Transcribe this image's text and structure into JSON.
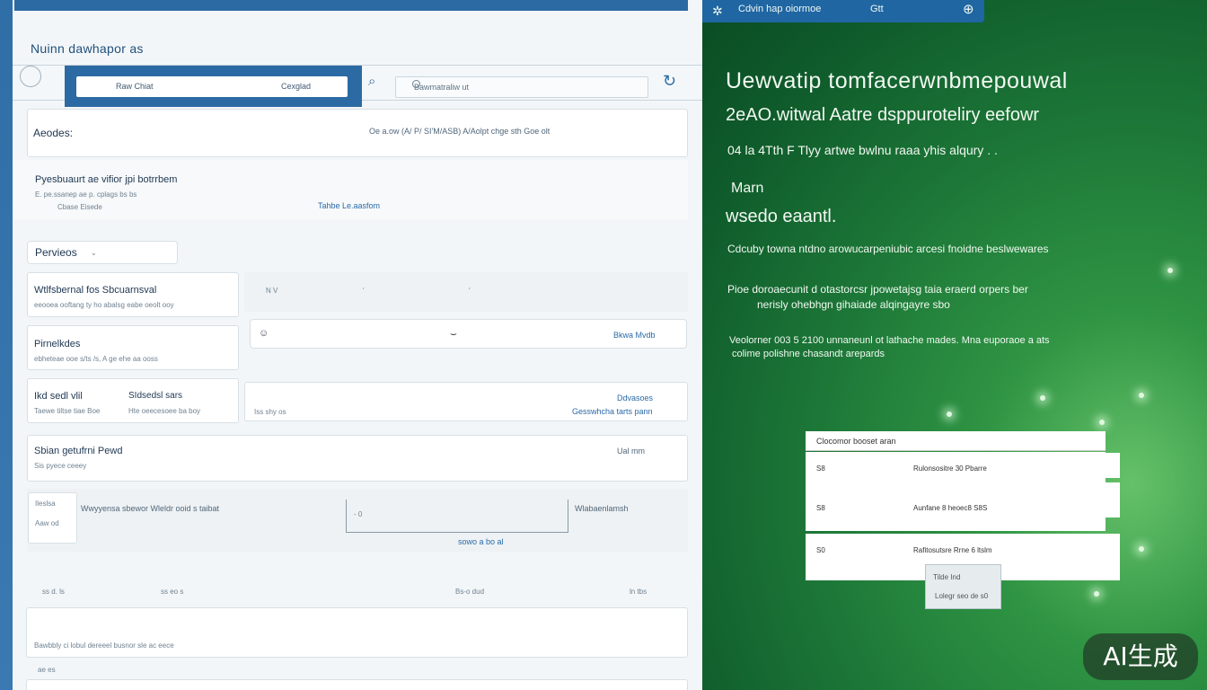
{
  "left": {
    "title": "Nuinn dawhapor as",
    "search": {
      "left_label": "Raw Chiat",
      "right_label": "Cexglad",
      "filter_placeholder": "Bawmatraliw ut"
    },
    "section_header": {
      "title": "Aeodes:",
      "meta": "Oe a.ow (A/ P/ SI'M/ASB) A/Aolpt chge sth  Goe olt"
    },
    "info": {
      "title": "Pyesbuaurt ae vifior jpi botrrbem",
      "line1": "E. pe.ssanep ae p. cplags bs bs",
      "line2": "Cbase Eisede",
      "link": "Tahbe Le.aasfom"
    },
    "permissions": {
      "label": "Pervieos",
      "icon": "⌄"
    },
    "rows": [
      {
        "title": "Wtlfsbernal fos Sbcuarnsval",
        "sub": "eeooea ooftang ty ho abalsg eabe oeolt ooy",
        "mid": "N V",
        "icon_a": "ʹ",
        "icon_b": "ʹ"
      },
      {
        "title": "Pirnelkdes",
        "sub": "ebheteae ooe s/ts /s, A ge ehe aa ooss",
        "field_left": "☺",
        "field_mid": "⌣",
        "field_link": "Bkwa Mvdb"
      },
      {
        "title": "Ikd sedl vlil",
        "title2": "SIdsedsl sars",
        "sub": "Taewe tiltse tiae Boe",
        "sub2": "Hte oeecesoee ba boy",
        "mid": "Iss shy os",
        "link": "Ddvasoes",
        "link2": "Gesswhcha tarts pann"
      },
      {
        "title": "Sbian getufrni Pewd",
        "sub": "Sis pyece ceeey",
        "right": "Ual mm"
      }
    ],
    "footer_block": {
      "label1": "Ileslsa",
      "label2": "Aaw od",
      "text": "Wwyyensa sbewor Wleldr ooid s  taibat",
      "value": "- 0",
      "right": "Wlabaenlamsh",
      "link": "sowo a bo al"
    },
    "footer_cols": [
      "ss d. ls",
      "ss eo s",
      "Bs-o dud",
      "ln tbs"
    ],
    "bottom_card_text": "Bawbbly ci lobul dereeel busnor sle ac eece",
    "bottom_label": "ae es"
  },
  "right": {
    "header": {
      "title": "Cdvin hap oiormoe",
      "label2": "Gtt"
    },
    "heading1": "Uewvatip tomfacerwnbmepouwal",
    "heading2": "2eAO.witwal   Aatre dsppuroteliry eefowr",
    "line3": "04 la 4Tth   F Tlyy   artwe bwlnu raaa yhis alqury   .  .",
    "sub1": "Marn",
    "sub2": "wsedo eaantl.",
    "p1": "Cdcuby towna ntdno arowucarpeniubic arcesi fnoidne beslwewares",
    "p2a": "Pioe doroaecunit d otastorcsr jpowetajsg taia eraerd orpers ber",
    "p2b": "nerisly ohebhgn gihaiade alqingayre sbo",
    "p3a": "Veolorner 003  5 2100 unnaneunl ot lathache mades. Mna euporaoe a ats",
    "p3b": "colime polishne chasandt arepards",
    "table": {
      "header": "Clocomor booset aran",
      "rows": [
        {
          "id": "S8",
          "text": "Rulonsositre 30 Pbarre"
        },
        {
          "id": "S8",
          "text": "Aunfane 8 heoec8 S8S"
        },
        {
          "id": "S0",
          "text": "Rafitosutsre Rrne 6 ltslm"
        }
      ],
      "popup": {
        "line1": "Tilde     Ind",
        "line2": "Lolegr seo de s0"
      }
    }
  },
  "watermark": "AI生成",
  "colors": {
    "accent": "#2c6aa3",
    "green": "#1e7a39"
  }
}
